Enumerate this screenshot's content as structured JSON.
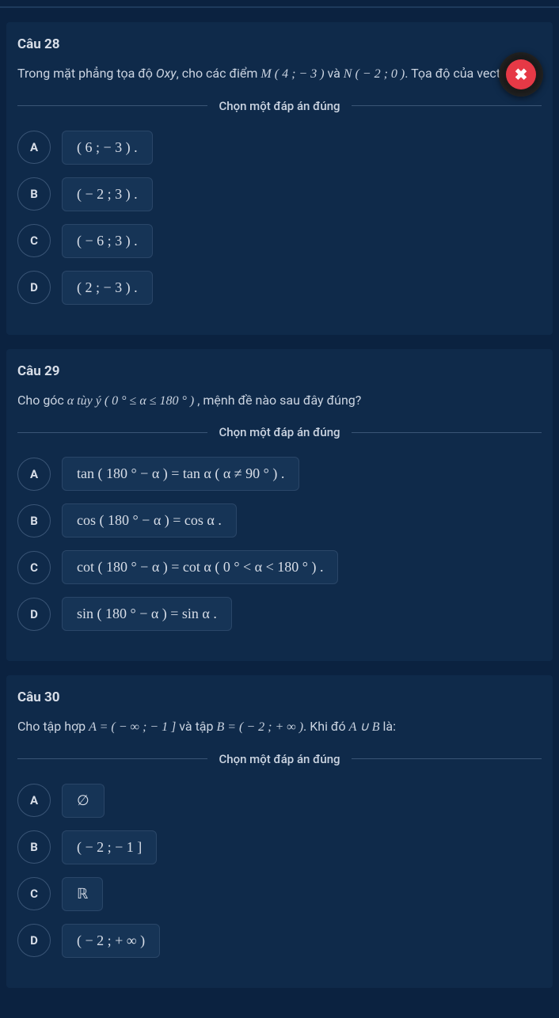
{
  "ui": {
    "choose_label": "Chọn một đáp án đúng",
    "close_icon": "✖"
  },
  "q28": {
    "title": "Câu 28",
    "text_prefix": "Trong mặt phẳng tọa độ ",
    "oxy": "Oxy",
    "text_mid": ", cho các điểm ",
    "pointM": "M ( 4 ; − 3 )",
    "va": " và ",
    "pointN": "N ( − 2 ; 0 )",
    "text_suffix": ". Tọa độ của vectơ ",
    "options": {
      "A": "( 6 ; − 3 ) .",
      "B": "( − 2 ; 3 ) .",
      "C": "( − 6 ; 3 ) .",
      "D": "( 2 ; − 3 ) ."
    }
  },
  "q29": {
    "title": "Câu 29",
    "text_prefix": "Cho góc ",
    "alpha": "α tùy ý",
    "range": " ( 0 ° ≤ α ≤ 180 ° ) ",
    "text_suffix": ", mệnh đề nào sau đây đúng?",
    "options": {
      "A": "tan ( 180 ° − α ) = tan α ( α ≠ 90 ° ) .",
      "B": "cos ( 180 ° − α ) = cos α .",
      "C": "cot ( 180 ° − α ) = cot α ( 0 ° < α < 180 ° ) .",
      "D": "sin ( 180 ° − α ) = sin α ."
    }
  },
  "q30": {
    "title": "Câu 30",
    "text_prefix": "Cho tập hợp ",
    "setA": "A = ( − ∞ ; − 1 ]",
    "va_tap": " và tập ",
    "setB": "B = ( − 2 ; + ∞ )",
    "khi_do": ". Khi đó ",
    "union": "A ∪ B",
    "la": " là:",
    "options": {
      "A": "∅",
      "B": "( − 2 ; − 1 ]",
      "C": "ℝ",
      "D": "( − 2 ; + ∞ )"
    }
  },
  "letters": {
    "A": "A",
    "B": "B",
    "C": "C",
    "D": "D"
  }
}
